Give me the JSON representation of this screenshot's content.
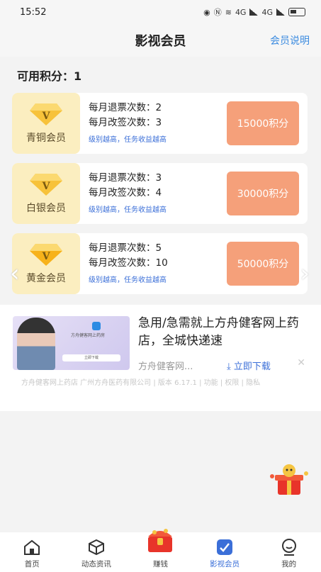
{
  "status": {
    "time": "15:52",
    "net1": "4G",
    "net2": "4G"
  },
  "header": {
    "title": "影视会员",
    "link": "会员说明"
  },
  "points_label": "可用积分：1",
  "tiers": [
    {
      "name": "青铜会员",
      "refund": "每月退票次数：2",
      "change": "每月改签次数：3",
      "hint": "级别越高，任务收益越高",
      "price": "15000积分"
    },
    {
      "name": "白银会员",
      "refund": "每月退票次数：3",
      "change": "每月改签次数：4",
      "hint": "级别越高，任务收益越高",
      "price": "30000积分"
    },
    {
      "name": "黄金会员",
      "refund": "每月退票次数：5",
      "change": "每月改签次数：10",
      "hint": "级别越高，任务收益越高",
      "price": "50000积分"
    }
  ],
  "ad": {
    "headline": "急用/急需就上方舟健客网上药店，全城快递速",
    "source": "方舟健客网...",
    "download": "⤓ 立即下载",
    "close": "✕",
    "meta": "方舟健客网上药店 广州方舟医药有限公司 | 版本 6.17.1 | 功能 | 权限 | 隐私",
    "image_title": "方舟健客网上药房",
    "image_button": "立即下载"
  },
  "tabs": [
    {
      "label": "首页"
    },
    {
      "label": "动态资讯"
    },
    {
      "label": "赚钱"
    },
    {
      "label": "影视会员"
    },
    {
      "label": "我的"
    }
  ],
  "colors": {
    "accent": "#3b6fd8",
    "price": "#f5a07a",
    "badge_bg": "#fbeec0"
  }
}
